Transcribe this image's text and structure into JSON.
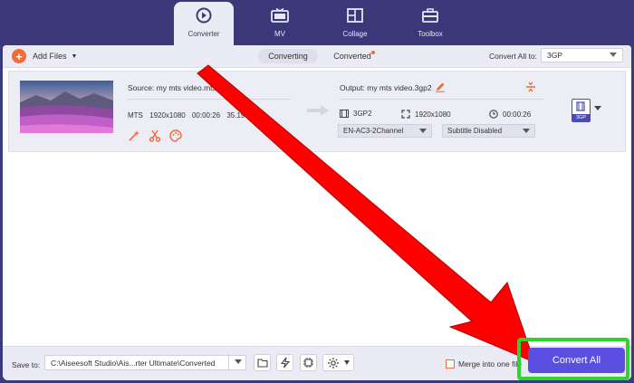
{
  "nav": {
    "tabs": [
      {
        "label": "Converter",
        "icon": "converter-icon",
        "active": true
      },
      {
        "label": "MV",
        "icon": "tv-icon",
        "active": false
      },
      {
        "label": "Collage",
        "icon": "collage-icon",
        "active": false
      },
      {
        "label": "Toolbox",
        "icon": "toolbox-icon",
        "active": false
      }
    ]
  },
  "toolbar": {
    "add_files": "Add Files",
    "tabs": [
      {
        "label": "Converting",
        "active": true
      },
      {
        "label": "Converted",
        "active": false,
        "has_dot": true
      }
    ],
    "convert_all_to_label": "Convert All to:",
    "convert_all_to_value": "3GP"
  },
  "file": {
    "source_label": "Source: my mts video.mts",
    "format": "MTS",
    "resolution": "1920x1080",
    "duration": "00:00:26",
    "size": "35.19 MB",
    "output_label": "Output: my mts video.3gp2",
    "out_format": "3GP2",
    "out_resolution": "1920x1080",
    "out_duration": "00:00:26",
    "audio_track": "EN-AC3-2Channel",
    "subtitle": "Subtitle Disabled",
    "format_badge": "3GP"
  },
  "bottom": {
    "save_to_label": "Save to:",
    "save_path": "C:\\Aiseesoft Studio\\Ais...rter Ultimate\\Converted",
    "merge_label": "Merge into one file",
    "convert_all_button": "Convert All"
  },
  "colors": {
    "accent": "#5a4fe0",
    "orange": "#f26b3a",
    "highlight_green": "#2fd32f",
    "annotation_red": "#ff0000",
    "nav_bg": "#3a3878"
  }
}
